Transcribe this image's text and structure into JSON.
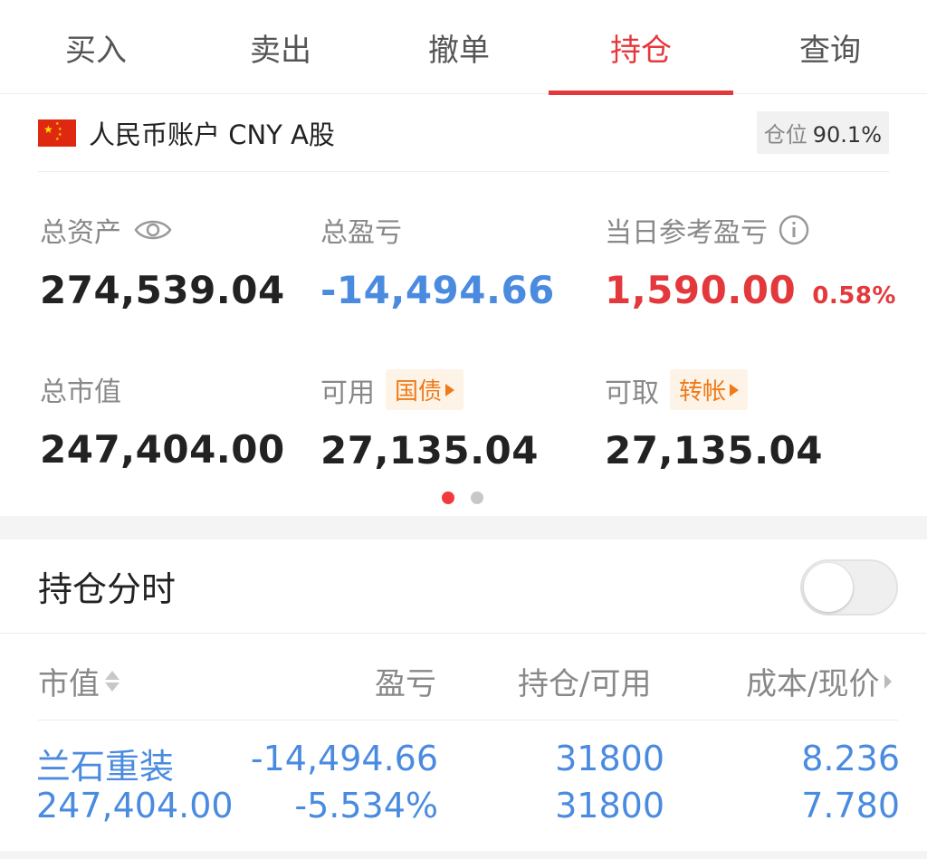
{
  "tabs": [
    "买入",
    "卖出",
    "撤单",
    "持仓",
    "查询"
  ],
  "active_tab": "持仓",
  "account": {
    "name": "人民币账户 CNY A股",
    "position_label": "仓位",
    "position_value": "90.1%"
  },
  "summary": {
    "total_assets_label": "总资产",
    "total_assets": "274,539.04",
    "total_pnl_label": "总盈亏",
    "total_pnl": "-14,494.66",
    "daily_pnl_label": "当日参考盈亏",
    "daily_pnl": "1,590.00",
    "daily_pnl_pct": "0.58%",
    "market_value_label": "总市值",
    "market_value": "247,404.00",
    "available_label": "可用",
    "available_tag": "国债",
    "available": "27,135.04",
    "withdrawable_label": "可取",
    "withdrawable_tag": "转帐",
    "withdrawable": "27,135.04"
  },
  "fenshi": {
    "label": "持仓分时",
    "enabled": false
  },
  "table": {
    "headers": [
      "市值",
      "盈亏",
      "持仓/可用",
      "成本/现价"
    ],
    "rows": [
      {
        "name": "兰石重装",
        "market_value": "247,404.00",
        "pnl": "-14,494.66",
        "pnl_pct": "-5.534%",
        "holding": "31800",
        "available": "31800",
        "cost": "8.236",
        "price": "7.780"
      }
    ]
  },
  "colors": {
    "accent_red": "#e4393c",
    "blue": "#4a8be0",
    "orange": "#f07a1a"
  },
  "icons": [
    "cn-flag-icon",
    "eye-icon",
    "info-icon",
    "sort-icon",
    "chevron-right-icon"
  ]
}
